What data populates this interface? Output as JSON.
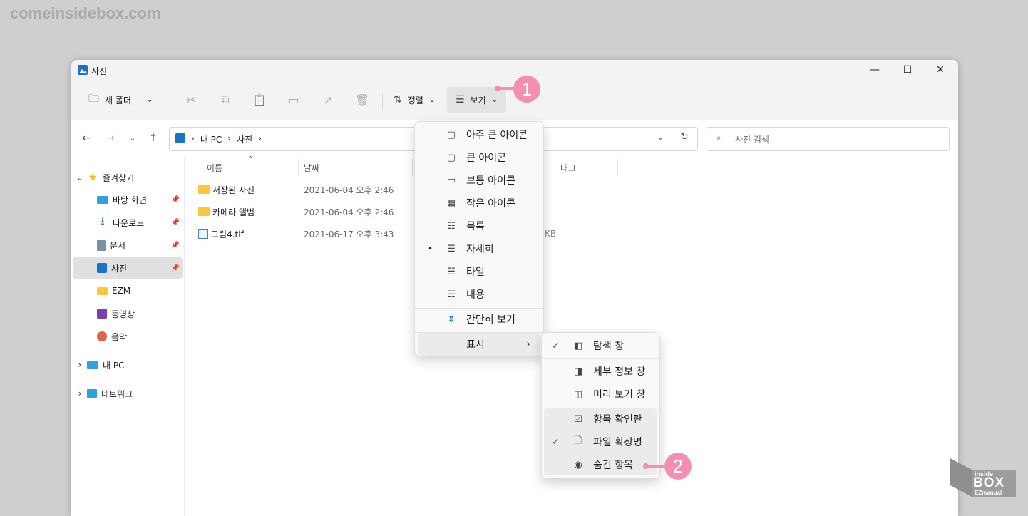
{
  "watermark": "comeinsidebox.com",
  "window": {
    "title": "사진"
  },
  "toolbar": {
    "new_folder": "새 폴더",
    "sort": "정렬",
    "view": "보기"
  },
  "address": {
    "crumbs": [
      "내 PC",
      "사진"
    ]
  },
  "search": {
    "placeholder": "사진 검색"
  },
  "sidebar": {
    "favorites": "즐겨찾기",
    "items": [
      {
        "label": "바탕 화면",
        "icon": "desktop-icon",
        "pinned": true
      },
      {
        "label": "다운로드",
        "icon": "download-icon",
        "pinned": true
      },
      {
        "label": "문서",
        "icon": "document-icon",
        "pinned": true
      },
      {
        "label": "사진",
        "icon": "pictures-icon",
        "pinned": true,
        "selected": true
      },
      {
        "label": "EZM",
        "icon": "folder-icon",
        "pinned": false
      },
      {
        "label": "동영상",
        "icon": "video-icon",
        "pinned": false
      },
      {
        "label": "음악",
        "icon": "music-icon",
        "pinned": false
      }
    ],
    "this_pc": "내 PC",
    "network": "네트워크"
  },
  "columns": {
    "name": "이름",
    "date": "날짜",
    "tags": "태그"
  },
  "files": [
    {
      "name": "저장된 사진",
      "date": "2021-06-04 오후 2:46",
      "icon": "folder-icon"
    },
    {
      "name": "카메라 앨범",
      "date": "2021-06-04 오후 2:46",
      "icon": "folder-icon"
    },
    {
      "name": "그림4.tif",
      "date": "2021-06-17 오후 3:43",
      "icon": "image-file-icon",
      "size_fragment": "KB"
    }
  ],
  "view_menu": {
    "items": [
      "아주 큰 아이콘",
      "큰 아이콘",
      "보통 아이콘",
      "작은 아이콘",
      "목록",
      "자세히",
      "타일",
      "내용"
    ],
    "selected": "자세히",
    "compact": "간단히 보기",
    "show": "표시"
  },
  "show_menu": {
    "items": [
      {
        "label": "탐색 창",
        "checked": true
      },
      {
        "label": "세부 정보 창",
        "checked": false
      },
      {
        "label": "미리 보기 창",
        "checked": false
      },
      {
        "label": "항목 확인란",
        "checked": false
      },
      {
        "label": "파일 확장명",
        "checked": true
      },
      {
        "label": "숨긴 항목",
        "checked": false
      }
    ]
  },
  "badges": [
    "1",
    "2"
  ],
  "corner_logo": {
    "top": "inside",
    "middle": "BOX",
    "bottom": "EZmanual"
  },
  "colors": {
    "accent": "#0067c0",
    "badge": "#f48fb1"
  }
}
